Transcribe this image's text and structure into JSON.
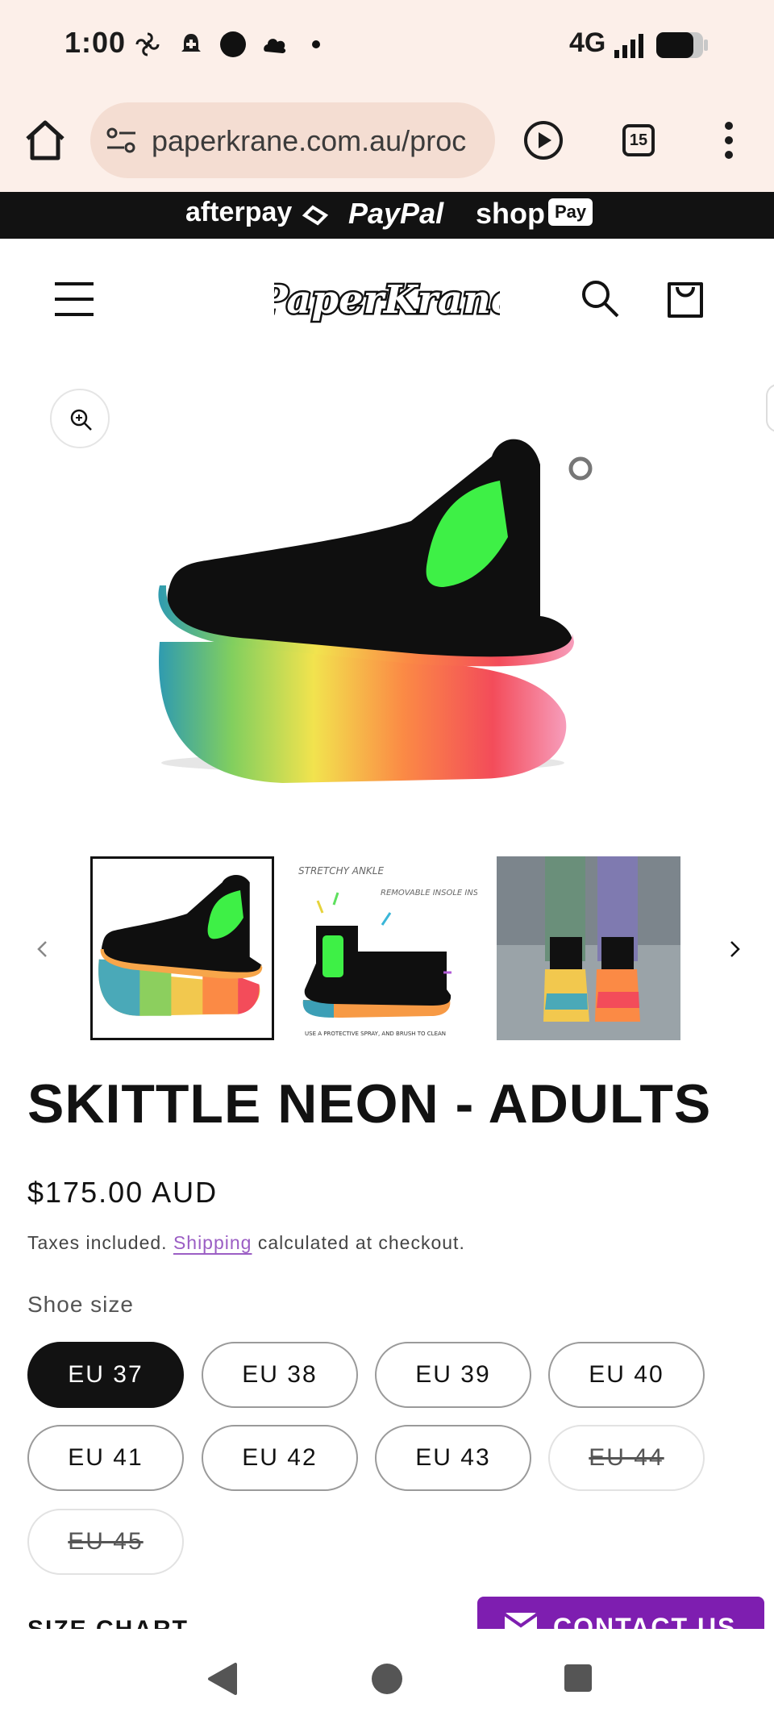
{
  "status": {
    "time": "1:00",
    "network": "4G"
  },
  "browser": {
    "url": "paperkrane.com.au/proc",
    "tab_count": "15"
  },
  "payments": {
    "afterpay": "afterpay",
    "paypal": "PayPal",
    "shop": "shop",
    "shop_badge": "Pay"
  },
  "brand": {
    "logo_text": "PaperKrane"
  },
  "product": {
    "title": "SKITTLE NEON - ADULTS",
    "price": "$175.00 AUD",
    "tax_prefix": "Taxes included. ",
    "tax_link": "Shipping",
    "tax_suffix": " calculated at checkout.",
    "size_label": "Shoe size",
    "sizes": [
      {
        "label": "EU 37"
      },
      {
        "label": "EU 38"
      },
      {
        "label": "EU 39"
      },
      {
        "label": "EU 40"
      },
      {
        "label": "EU 41"
      },
      {
        "label": "EU 42"
      },
      {
        "label": "EU 43"
      },
      {
        "label": "EU 44"
      },
      {
        "label": "EU 45"
      }
    ],
    "size_chart": "SIZE CHART"
  },
  "thumbnail_2_texts": {
    "stretchy": "STRETCHY ANKLE",
    "insole": "REMOVABLE INSOLE INSIDE",
    "caption": "USE A PROTECTIVE SPRAY, AND BRUSH TO CLEAN"
  },
  "contact": {
    "label": "CONTACT US"
  },
  "colors": {
    "status_bg": "#fcefe9",
    "url_pill": "#f4ddd2",
    "accent_link": "#9b5ec4",
    "contact_bg": "#7e1eb0",
    "neon_green": "#3ef046"
  }
}
